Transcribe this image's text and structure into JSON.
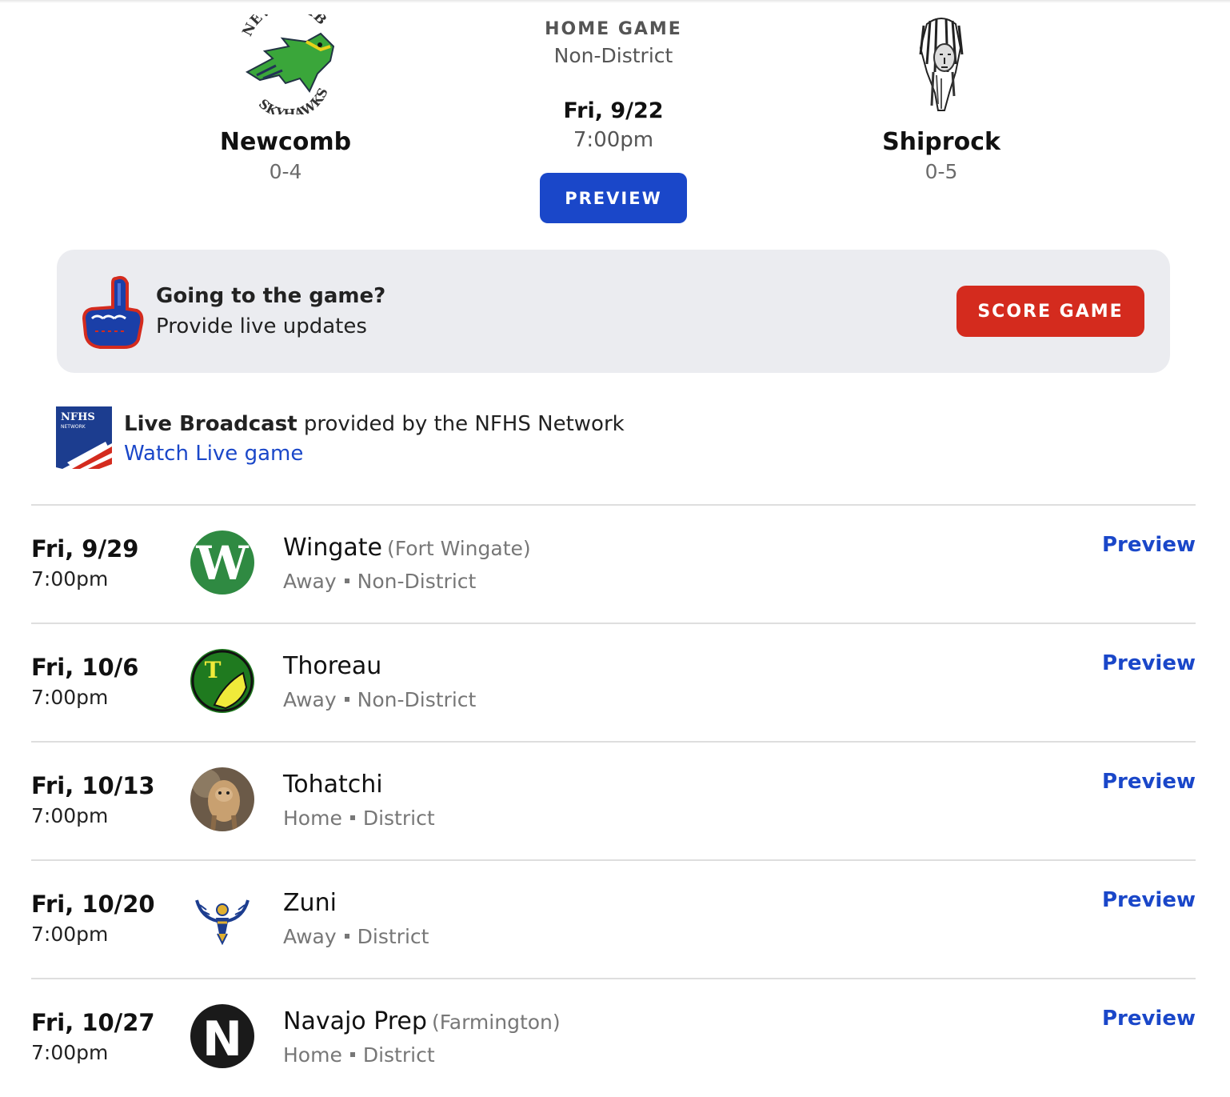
{
  "game": {
    "home_team": {
      "name": "Newcomb",
      "record": "0-4",
      "logo_text_top": "NEWCOMB",
      "logo_text_bottom": "SKYHAWKS"
    },
    "away_team": {
      "name": "Shiprock",
      "record": "0-5"
    },
    "type": "HOME GAME",
    "district": "Non-District",
    "date": "Fri, 9/22",
    "time": "7:00pm",
    "preview_label": "PREVIEW"
  },
  "score_card": {
    "title": "Going to the game?",
    "subtitle": "Provide live updates",
    "button_label": "SCORE GAME"
  },
  "broadcast": {
    "bold": "Live Broadcast",
    "rest": " provided by the NFHS Network",
    "link": "Watch Live game",
    "logo_text": "NFHS",
    "logo_subtext": "NETWORK"
  },
  "schedule": [
    {
      "date": "Fri, 9/29",
      "time": "7:00pm",
      "opponent": "Wingate",
      "location": "(Fort Wingate)",
      "home_away": "Away",
      "district": "Non-District",
      "logo_letter": "W",
      "preview": "Preview"
    },
    {
      "date": "Fri, 10/6",
      "time": "7:00pm",
      "opponent": "Thoreau",
      "location": "",
      "home_away": "Away",
      "district": "Non-District",
      "logo_letter": "T",
      "preview": "Preview"
    },
    {
      "date": "Fri, 10/13",
      "time": "7:00pm",
      "opponent": "Tohatchi",
      "location": "",
      "home_away": "Home",
      "district": "District",
      "logo_letter": "",
      "preview": "Preview"
    },
    {
      "date": "Fri, 10/20",
      "time": "7:00pm",
      "opponent": "Zuni",
      "location": "",
      "home_away": "Away",
      "district": "District",
      "logo_letter": "",
      "preview": "Preview"
    },
    {
      "date": "Fri, 10/27",
      "time": "7:00pm",
      "opponent": "Navajo Prep",
      "location": "(Farmington)",
      "home_away": "Home",
      "district": "District",
      "logo_letter": "N",
      "preview": "Preview"
    }
  ],
  "colors": {
    "accent_blue": "#1a47c9",
    "score_red": "#d42b1e",
    "card_bg": "#ebecf0"
  }
}
